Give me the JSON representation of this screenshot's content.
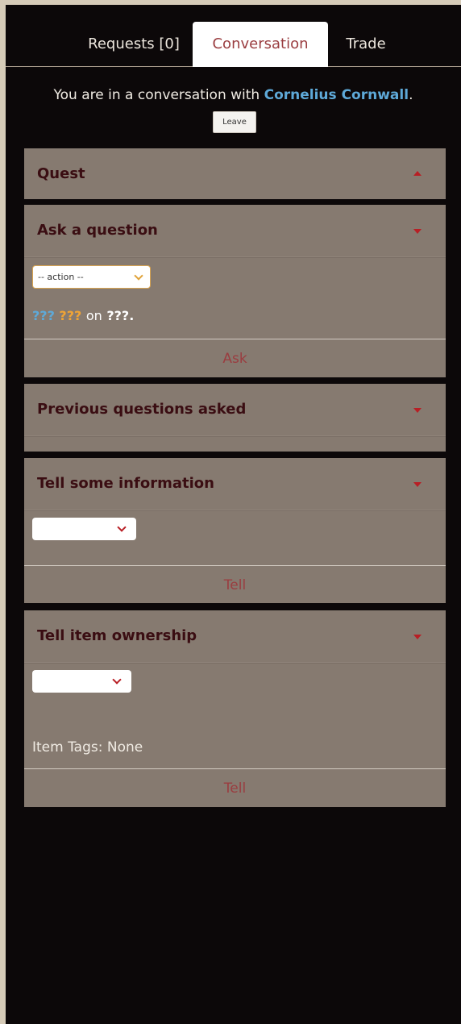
{
  "tabs": {
    "requests": "Requests [0]",
    "conversation": "Conversation",
    "trade": "Trade"
  },
  "conversation": {
    "prefix": "You are in a conversation with ",
    "name": "Cornelius Cornwall",
    "suffix": ".",
    "leave": "Leave"
  },
  "panels": {
    "quest": {
      "title": "Quest"
    },
    "ask": {
      "title": "Ask a question",
      "select_value": "-- action --",
      "q1": "???",
      "q2": "???",
      "on": "on",
      "q3": "???.",
      "button": "Ask"
    },
    "previous": {
      "title": "Previous questions asked"
    },
    "tell_info": {
      "title": "Tell some information",
      "button": "Tell"
    },
    "tell_item": {
      "title": "Tell item ownership",
      "item_tags": "Item Tags: None",
      "button": "Tell"
    }
  },
  "colors": {
    "background": "#0c0809",
    "panel": "#867a70",
    "accent_red": "#9a3d40",
    "name_blue": "#5ea9d8",
    "question_orange": "#f0a435"
  }
}
